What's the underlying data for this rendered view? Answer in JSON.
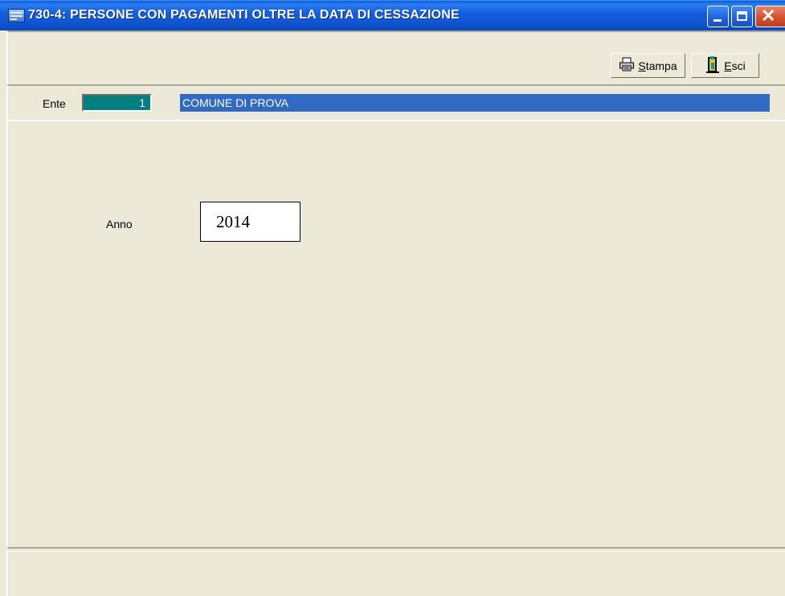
{
  "window": {
    "title": "730-4: PERSONE CON PAGAMENTI OLTRE LA DATA DI CESSAZIONE",
    "controls": [
      "minimize",
      "maximize",
      "close"
    ]
  },
  "toolbar": {
    "print_label_accel": "S",
    "print_label_rest": "tampa",
    "exit_label_accel": "E",
    "exit_label_rest": "sci"
  },
  "ente": {
    "label": "Ente",
    "code": "1",
    "name": "COMUNE DI PROVA"
  },
  "form": {
    "anno_label": "Anno",
    "anno_value": "2014"
  },
  "colors": {
    "titlebar": "#0F55D0",
    "window_bg": "#ECE9D8",
    "ente_code_bg": "#008080",
    "ente_name_bg": "#316AC5",
    "close_button": "#D5512E"
  },
  "icons": {
    "app": "app-icon",
    "print": "printer-icon",
    "exit": "door-exit-icon"
  }
}
